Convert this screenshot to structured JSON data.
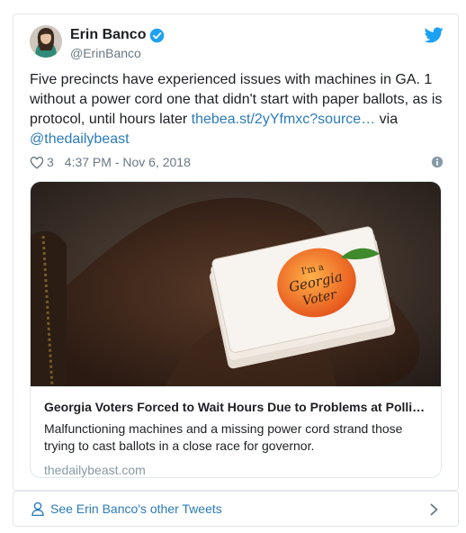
{
  "author": {
    "display_name": "Erin Banco",
    "handle": "@ErinBanco",
    "avatar": "avatar-image",
    "verified_icon": "verified-badge-icon"
  },
  "brand_icon": "twitter-bird-icon",
  "tweet": {
    "text_prefix": "Five precincts have experienced issues with machines in GA. 1 without a power cord one that didn't start with paper ballots, as is protocol, until hours later ",
    "link_text": "thebea.st/2yYfmxc?source…",
    "text_via": " via ",
    "mention": "@thedailybeast"
  },
  "meta": {
    "like_icon": "heart-icon",
    "like_count": "3",
    "timestamp": "4:37 PM - Nov 6, 2018",
    "info_icon": "info-icon"
  },
  "card": {
    "image": "card-photo-georgia-voter-sticker",
    "sticker_text": "I'm a Georgia Voter",
    "title": "Georgia Voters Forced to Wait Hours Due to Problems at Polli…",
    "description": "Malfunctioning machines and a missing power cord strand those trying to cast ballots in a close race for governor.",
    "domain": "thedailybeast.com"
  },
  "footer": {
    "icon": "person-icon",
    "label": "See Erin Banco's other Tweets",
    "chevron_icon": "chevron-right-icon"
  },
  "colors": {
    "link": "#2b7bb9",
    "verified": "#1da1f2",
    "secondary_text": "#697882",
    "border": "#e1e8ed"
  }
}
